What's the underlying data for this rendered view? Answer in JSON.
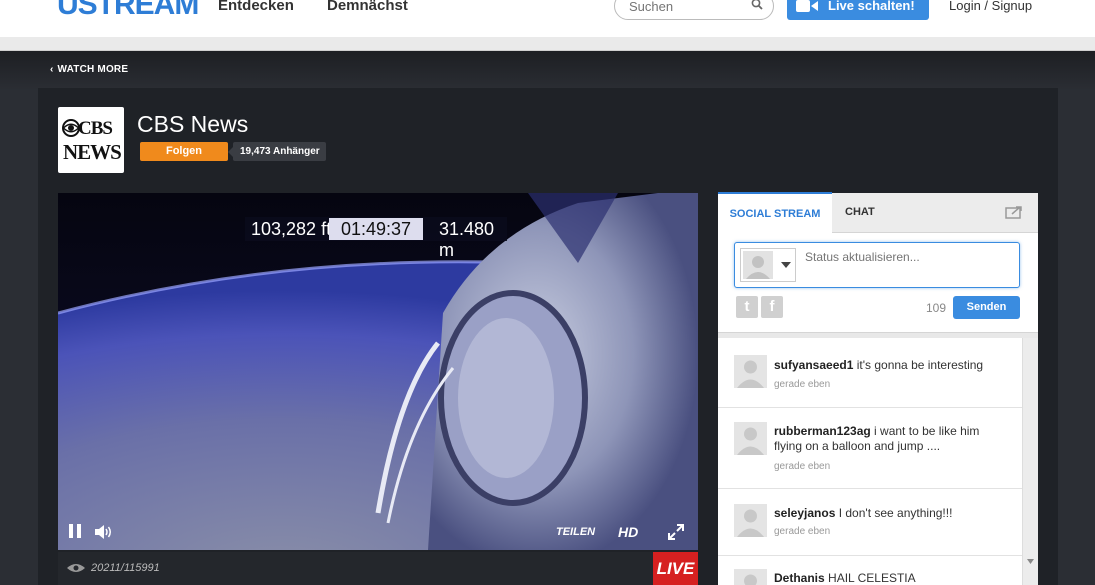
{
  "header": {
    "logo": "USTREAM",
    "nav": [
      "Entdecken",
      "Demnächst"
    ],
    "search_placeholder": "Suchen",
    "live_button": "Live schalten!",
    "login": "Login / Signup"
  },
  "watch_more": "WATCH MORE",
  "channel": {
    "logo_line1": "CBS",
    "logo_line2": "NEWS",
    "name": "CBS News",
    "follow": "Folgen",
    "followers": "19,473 Anhänger"
  },
  "player": {
    "hud_alt_ft": "103,282 ft",
    "hud_time": "01:49:37",
    "hud_alt_m": "31.480 m",
    "share": "TEILEN",
    "hd": "HD",
    "viewers": "20211/115991",
    "live": "LIVE"
  },
  "social": {
    "tab_social": "SOCIAL STREAM",
    "tab_chat": "CHAT",
    "status_placeholder": "Status aktualisieren...",
    "twitter": "t",
    "facebook": "f",
    "char_count": "109",
    "send": "Senden",
    "posts": [
      {
        "user": "sufyansaeed1",
        "text": "it's gonna be interesting",
        "time": "gerade eben"
      },
      {
        "user": "rubberman123ag",
        "text": "i want to be like him flying on a balloon and jump ....",
        "time": "gerade eben"
      },
      {
        "user": "seleyjanos",
        "text": "I don't see anything!!!",
        "time": "gerade eben"
      },
      {
        "user": "Dethanis",
        "text": "HAIL CELESTIA",
        "time": ""
      }
    ]
  }
}
